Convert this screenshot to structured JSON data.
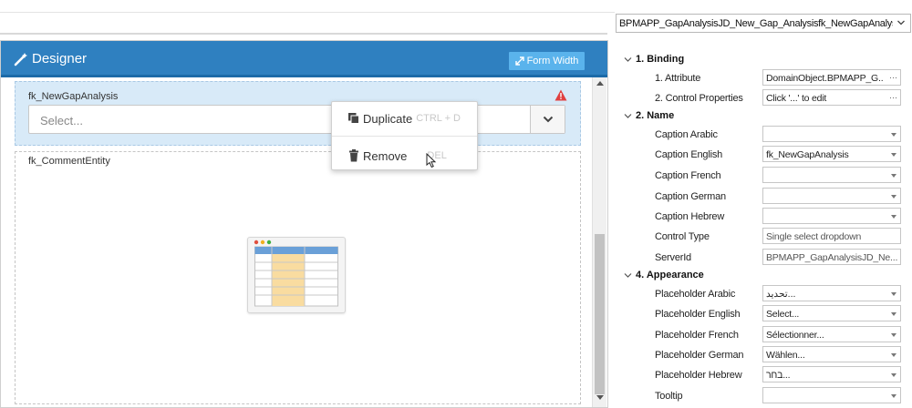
{
  "designer": {
    "title": "Designer",
    "form_width_label": "Form Width",
    "fields": [
      {
        "label": "fk_NewGapAnalysis",
        "placeholder": "Select..."
      },
      {
        "label": "fk_CommentEntity"
      }
    ]
  },
  "context_menu": {
    "duplicate_label": "Duplicate",
    "duplicate_shortcut": "CTRL + D",
    "remove_label": "Remove",
    "remove_shortcut": "DEL"
  },
  "properties": {
    "object_selector": "BPMAPP_GapAnalysisJD_New_Gap_Analysisfk_NewGapAnalysis",
    "sections": {
      "binding": "1. Binding",
      "name": "2. Name",
      "appearance": "4. Appearance"
    },
    "rows": [
      {
        "label": "1. Attribute",
        "value": "DomainObject.BPMAPP_G...",
        "kind": "button"
      },
      {
        "label": "2. Control Properties",
        "value": "Click '...' to edit",
        "kind": "button"
      },
      {
        "label": "Caption Arabic",
        "value": "",
        "kind": "dropdown"
      },
      {
        "label": "Caption English",
        "value": "fk_NewGapAnalysis",
        "kind": "dropdown"
      },
      {
        "label": "Caption French",
        "value": "",
        "kind": "dropdown"
      },
      {
        "label": "Caption German",
        "value": "",
        "kind": "dropdown"
      },
      {
        "label": "Caption Hebrew",
        "value": "",
        "kind": "dropdown"
      },
      {
        "label": "Control Type",
        "value": "Single select dropdown",
        "kind": "readonly"
      },
      {
        "label": "ServerId",
        "value": "BPMAPP_GapAnalysisJD_Ne...",
        "kind": "readonly"
      },
      {
        "label": "Placeholder Arabic",
        "value": "تحديد...",
        "kind": "dropdown"
      },
      {
        "label": "Placeholder English",
        "value": "Select...",
        "kind": "dropdown"
      },
      {
        "label": "Placeholder French",
        "value": "Sélectionner...",
        "kind": "dropdown"
      },
      {
        "label": "Placeholder German",
        "value": "Wählen...",
        "kind": "dropdown"
      },
      {
        "label": "Placeholder Hebrew",
        "value": "בחר...",
        "kind": "dropdown"
      },
      {
        "label": "Tooltip",
        "value": "",
        "kind": "dropdown"
      }
    ]
  },
  "colors": {
    "header_blue": "#2f80c0",
    "button_blue": "#5ab3ec",
    "selected_field": "#d8eaf8",
    "warning_red": "#e04040"
  }
}
